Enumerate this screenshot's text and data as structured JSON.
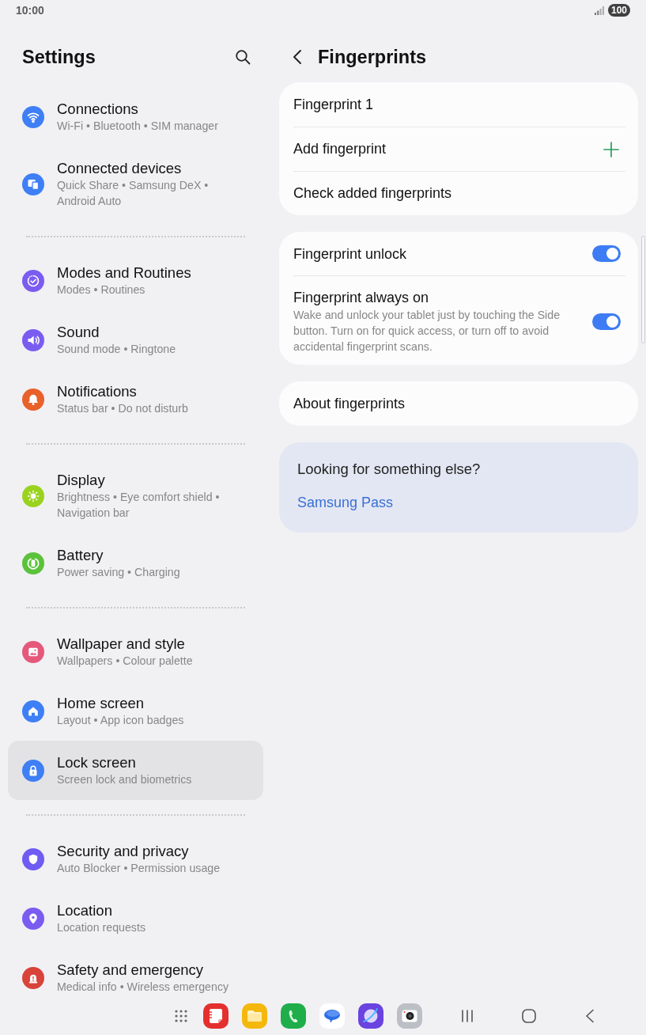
{
  "status_bar": {
    "time": "10:00",
    "battery": "100"
  },
  "sidebar": {
    "title": "Settings",
    "groups": [
      {
        "items": [
          {
            "title": "Connections",
            "subtitle": "Wi-Fi • Bluetooth • SIM manager",
            "color": "#3e7ff5",
            "selected": false
          },
          {
            "title": "Connected devices",
            "subtitle": "Quick Share • Samsung DeX • Android Auto",
            "color": "#3e7ff5",
            "selected": false
          }
        ]
      },
      {
        "items": [
          {
            "title": "Modes and Routines",
            "subtitle": "Modes • Routines",
            "color": "#7b5cf0",
            "selected": false
          },
          {
            "title": "Sound",
            "subtitle": "Sound mode • Ringtone",
            "color": "#7b5cf0",
            "selected": false
          },
          {
            "title": "Notifications",
            "subtitle": "Status bar • Do not disturb",
            "color": "#e8612a",
            "selected": false
          }
        ]
      },
      {
        "items": [
          {
            "title": "Display",
            "subtitle": "Brightness • Eye comfort shield • Navigation bar",
            "color": "#9bd21f",
            "selected": false
          },
          {
            "title": "Battery",
            "subtitle": "Power saving • Charging",
            "color": "#5bc23b",
            "selected": false
          }
        ]
      },
      {
        "items": [
          {
            "title": "Wallpaper and style",
            "subtitle": "Wallpapers • Colour palette",
            "color": "#e6587b",
            "selected": false
          },
          {
            "title": "Home screen",
            "subtitle": "Layout • App icon badges",
            "color": "#3e7ff5",
            "selected": false
          },
          {
            "title": "Lock screen",
            "subtitle": "Screen lock and biometrics",
            "color": "#3e7ff5",
            "selected": true
          }
        ]
      },
      {
        "items": [
          {
            "title": "Security and privacy",
            "subtitle": "Auto Blocker • Permission usage",
            "color": "#6f5cf2",
            "selected": false
          },
          {
            "title": "Location",
            "subtitle": "Location requests",
            "color": "#7b5cf0",
            "selected": false
          },
          {
            "title": "Safety and emergency",
            "subtitle": "Medical info • Wireless emergency",
            "color": "#d8433a",
            "selected": false
          }
        ]
      }
    ]
  },
  "detail": {
    "title": "Fingerprints",
    "cards": [
      {
        "rows": [
          {
            "kind": "link",
            "label": "Fingerprint 1"
          },
          {
            "kind": "add",
            "label": "Add fingerprint"
          },
          {
            "kind": "link",
            "label": "Check added fingerprints"
          }
        ]
      },
      {
        "rows": [
          {
            "kind": "toggle",
            "label": "Fingerprint unlock",
            "on": true
          },
          {
            "kind": "toggle",
            "label": "Fingerprint always on",
            "description": "Wake and unlock your tablet just by touching the Side button. Turn on for quick access, or turn off to avoid accidental fingerprint scans.",
            "on": true
          }
        ]
      },
      {
        "rows": [
          {
            "kind": "link",
            "label": "About fingerprints"
          }
        ]
      }
    ],
    "suggestions": {
      "title": "Looking for something else?",
      "links": [
        "Samsung Pass"
      ]
    }
  }
}
